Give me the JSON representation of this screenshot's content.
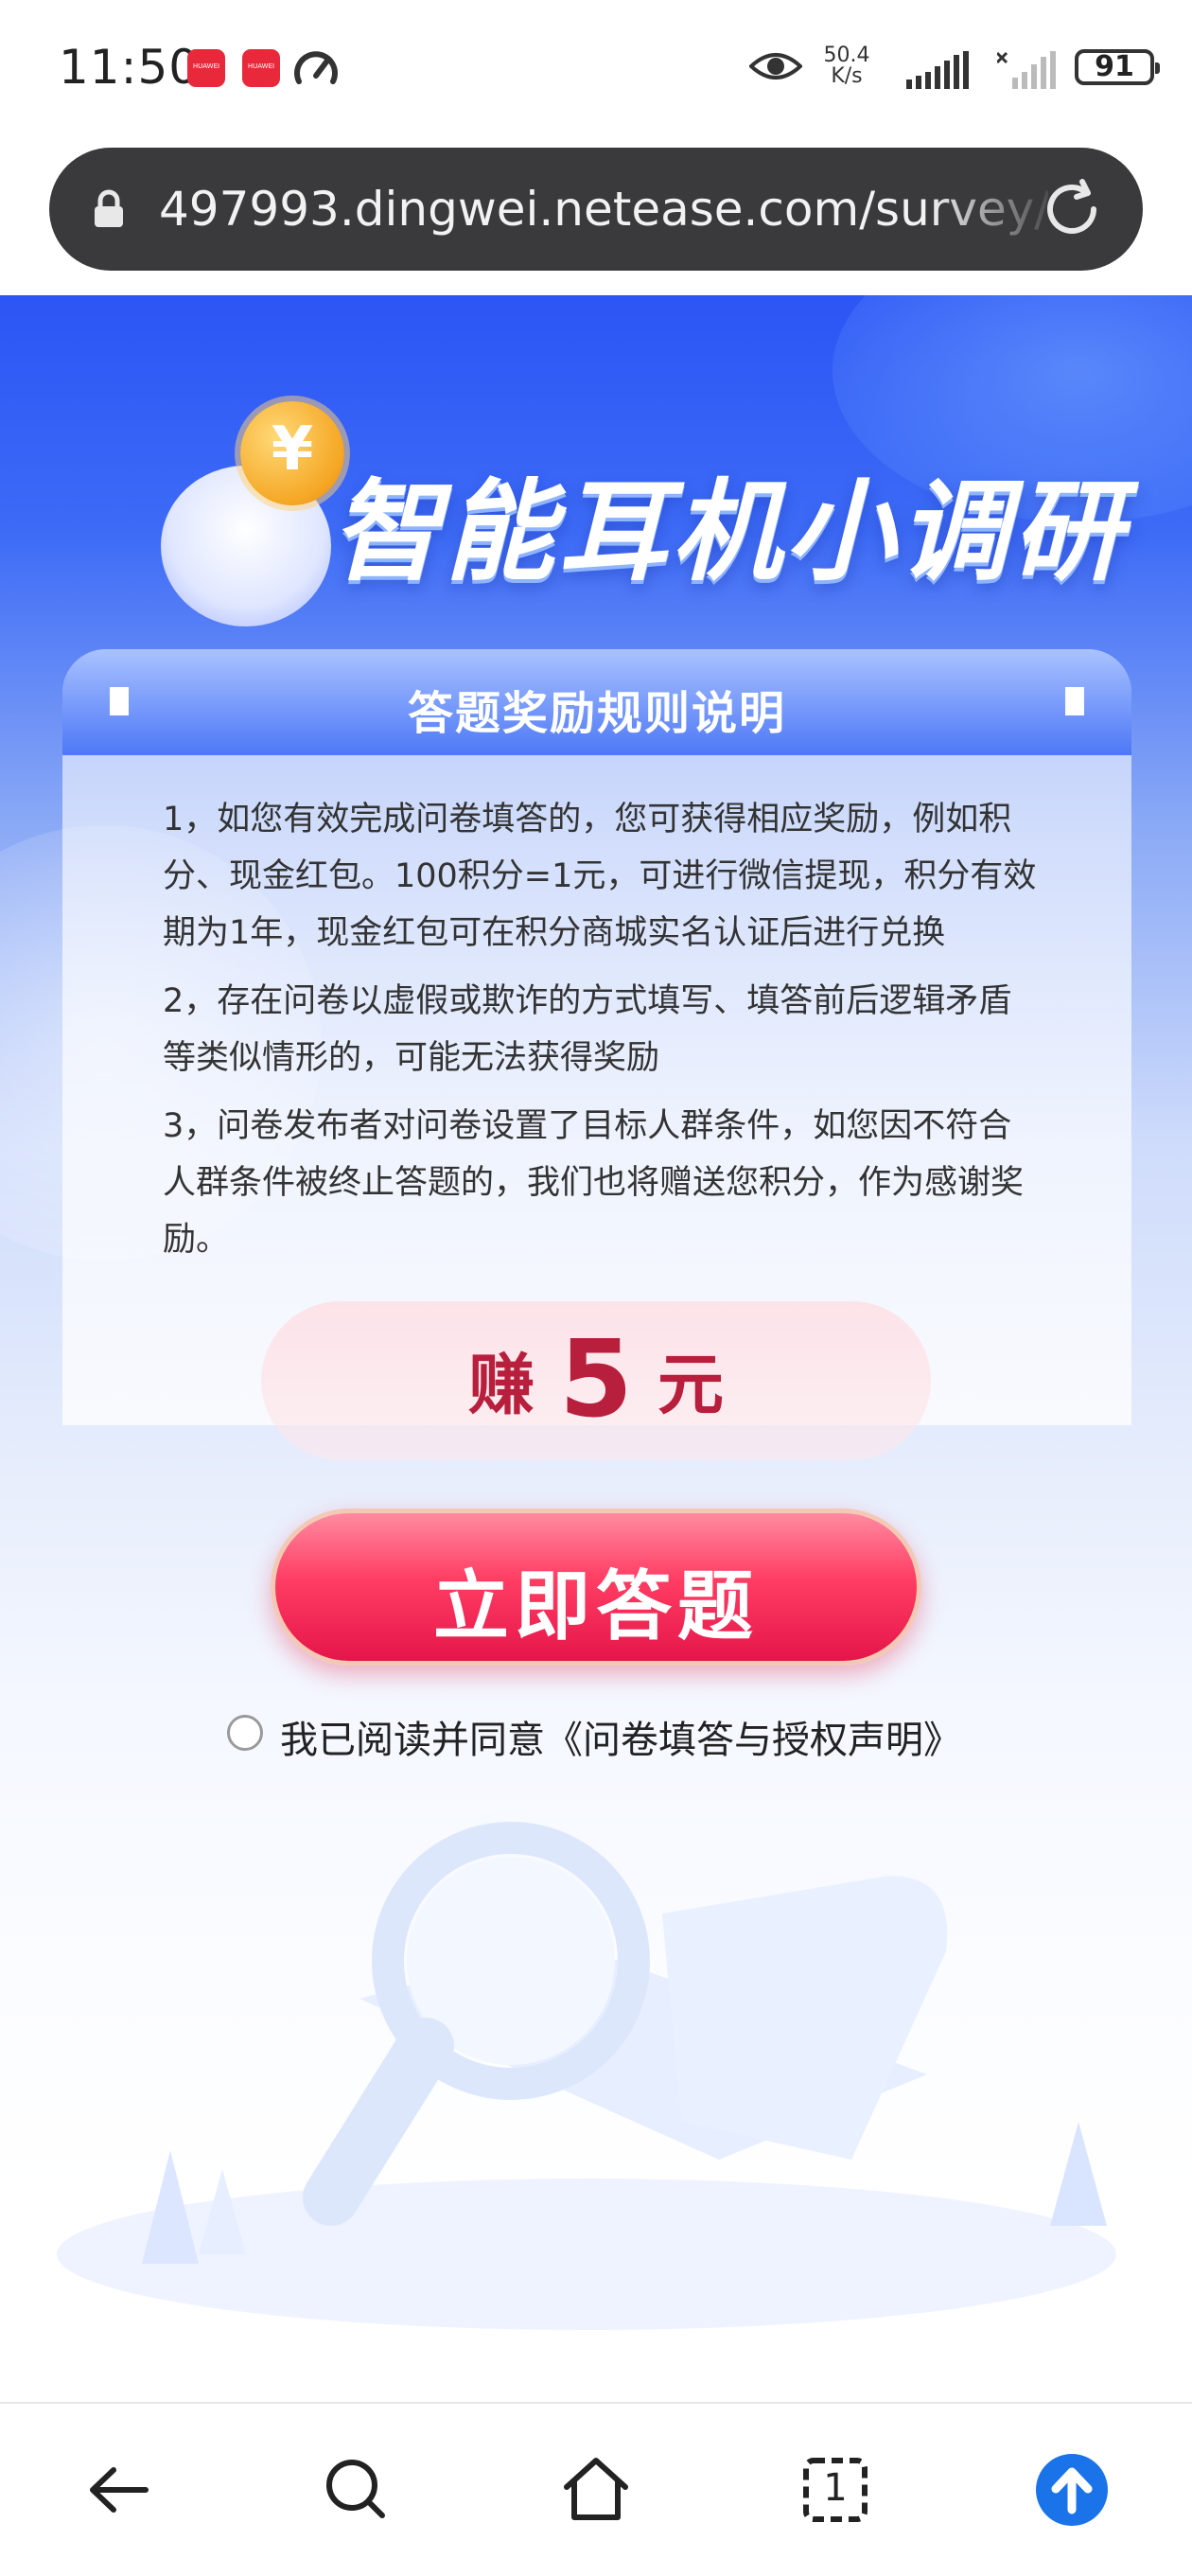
{
  "status_bar": {
    "time": "11:50",
    "app_badge_label": "HUAWEI",
    "net_speed_value": "50.4",
    "net_speed_unit": "K/s",
    "battery": "91"
  },
  "browser": {
    "url": "497993.dingwei.netease.com/survey/8",
    "url_bar_color": "#3a3a3c"
  },
  "hero": {
    "title": "智能耳机小调研",
    "coin_symbol": "¥"
  },
  "rules_card": {
    "title": "答题奖励规则说明",
    "rules": [
      "1，如您有效完成问卷填答的，您可获得相应奖励，例如积分、现金红包。100积分=1元，可进行微信提现，积分有效期为1年，现金红包可在积分商城实名认证后进行兑换",
      "2，存在问卷以虚假或欺诈的方式填写、填答前后逻辑矛盾等类似情形的，可能无法获得奖励",
      "3，问卷发布者对问卷设置了目标人群条件，如您因不符合人群条件被终止答题的，我们也将赠送您积分，作为感谢奖励。"
    ]
  },
  "reward": {
    "prefix": "赚",
    "amount": "5",
    "suffix": "元",
    "color": "#b81f3d"
  },
  "cta": {
    "label": "立即答题",
    "color": "#e5154a"
  },
  "agreement": {
    "text": "我已阅读并同意《问卷填答与授权声明》",
    "checked": false
  },
  "bottom_nav": {
    "items": [
      "back-icon",
      "search-icon",
      "home-icon",
      "tabs-icon",
      "upload-icon"
    ],
    "tab_count": "1",
    "accent": "#1a73e8"
  }
}
